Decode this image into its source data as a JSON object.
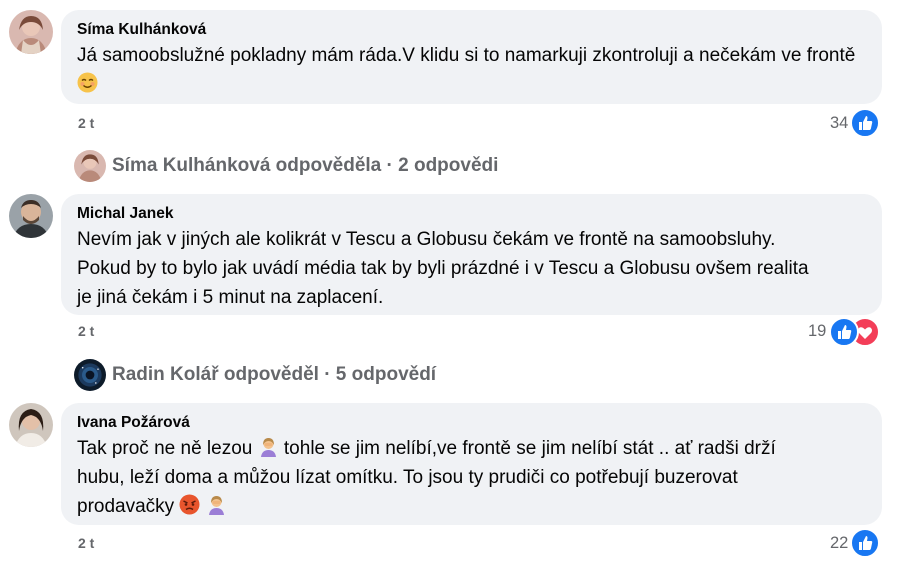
{
  "comments": [
    {
      "author": "Síma Kulhánková",
      "text_before_emoji": "Já samoobslužné pokladny mám ráda.V klidu si to namarkuji zkontroluji a nečekám ve frontě ",
      "emoji": "smiling-face-icon",
      "time": "2 t",
      "reaction_count": "34",
      "reactions": [
        "like-icon"
      ],
      "replies": {
        "text": "Síma Kulhánková odpověděla · 2 odpovědi"
      }
    },
    {
      "author": "Michal Janek",
      "text": "Nevím jak v jiných ale kolikrát v Tescu a Globusu čekám ve frontě na samoobsluhy.\nPokud by to bylo jak uvádí média tak by byli prázdné i v Tescu a Globusu ovšem realita\nje jiná čekám i 5 minut na zaplacení.",
      "time": "2 t",
      "reaction_count": "19",
      "reactions": [
        "like-icon",
        "heart-icon"
      ],
      "replies": {
        "text": "Radin Kolář odpověděl · 5 odpovědí"
      }
    },
    {
      "author": "Ivana Požárová",
      "text_line1_a": "Tak proč ne ně lezou ",
      "text_line1_b": " tohle se jim nelíbí,ve frontě se jim nelíbí stát .. ať radši drží",
      "text_line2": "hubu, leží doma a můžou lízat omítku. To jsou ty prudiči co potřebují buzerovat",
      "text_line3": "prodavačky ",
      "emojis": [
        "woman-facepalming-icon",
        "angry-face-icon",
        "woman-facepalming-icon"
      ],
      "time": "2 t",
      "reaction_count": "22",
      "reactions": [
        "like-icon"
      ]
    }
  ],
  "colors": {
    "bubble": "#f0f2f5",
    "meta": "#65676b",
    "like": "#1877f2",
    "heart": "#f33e58"
  }
}
